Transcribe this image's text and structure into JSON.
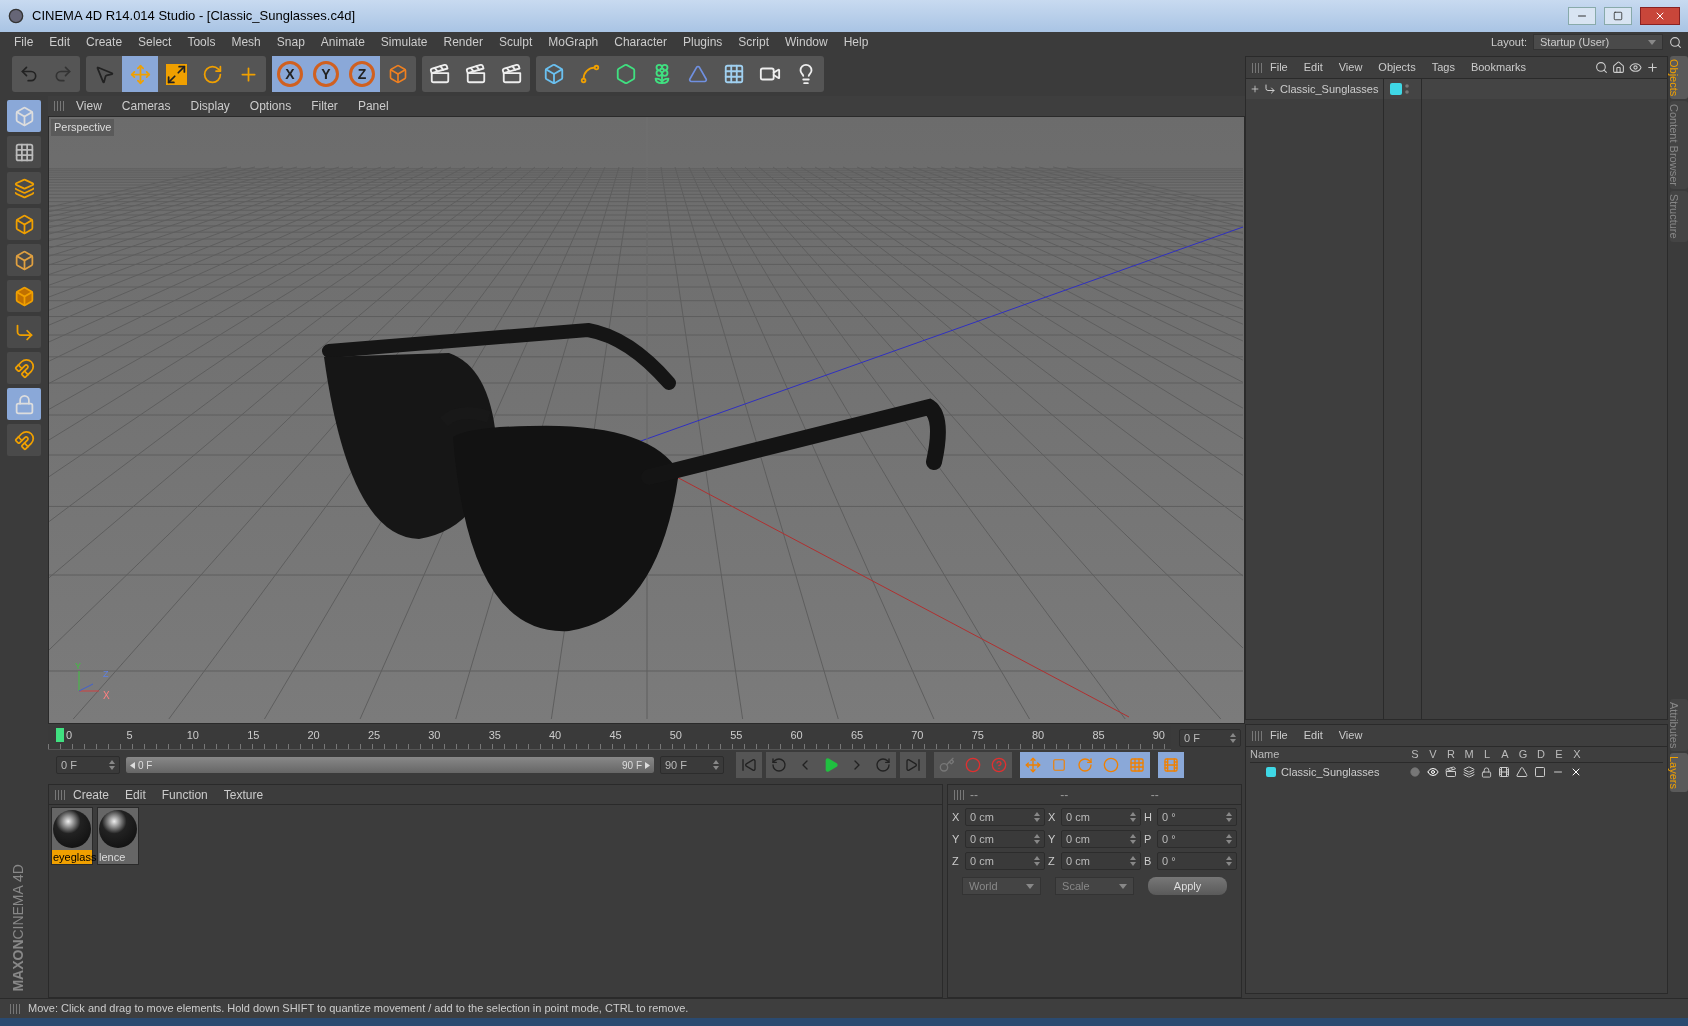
{
  "window": {
    "title": "CINEMA 4D R14.014 Studio - [Classic_Sunglasses.c4d]"
  },
  "menu": [
    "File",
    "Edit",
    "Create",
    "Select",
    "Tools",
    "Mesh",
    "Snap",
    "Animate",
    "Simulate",
    "Render",
    "Sculpt",
    "MoGraph",
    "Character",
    "Plugins",
    "Script",
    "Window",
    "Help"
  ],
  "layout": {
    "label": "Layout:",
    "value": "Startup (User)"
  },
  "tools": [
    {
      "kind": "select",
      "selected": false
    },
    {
      "kind": "move",
      "selected": true
    },
    {
      "kind": "scale",
      "selected": false
    },
    {
      "kind": "rotate",
      "selected": false
    },
    {
      "kind": "add",
      "selected": false
    }
  ],
  "axes": [
    {
      "label": "X",
      "selected": true
    },
    {
      "label": "Y",
      "selected": true
    },
    {
      "label": "Z",
      "selected": true
    }
  ],
  "left_tools": [
    {
      "kind": "model",
      "selected": true
    },
    {
      "kind": "texture",
      "selected": false
    },
    {
      "kind": "workplane",
      "selected": false
    },
    {
      "kind": "points",
      "selected": false
    },
    {
      "kind": "edges",
      "selected": false
    },
    {
      "kind": "polygons",
      "selected": false
    },
    {
      "kind": "axis",
      "selected": false
    },
    {
      "kind": "magnet",
      "selected": false
    },
    {
      "kind": "lock",
      "selected": true
    },
    {
      "kind": "snap",
      "selected": false
    }
  ],
  "viewport": {
    "menu": [
      "View",
      "Cameras",
      "Display",
      "Options",
      "Filter",
      "Panel"
    ],
    "label": "Perspective",
    "axis_labels": [
      "Y",
      "Z",
      "X"
    ]
  },
  "timeline": {
    "ticks": [
      "0",
      "5",
      "10",
      "15",
      "20",
      "25",
      "30",
      "35",
      "40",
      "45",
      "50",
      "55",
      "60",
      "65",
      "70",
      "75",
      "80",
      "85",
      "90"
    ],
    "current": "0 F",
    "start": "0 F",
    "range_start": "0 F",
    "range_end": "90 F",
    "range_bar": {
      "level": 1
    },
    "end": "90 F"
  },
  "materials": {
    "menu": [
      "Create",
      "Edit",
      "Function",
      "Texture"
    ],
    "items": [
      {
        "name": "eyeglass",
        "selected": true
      },
      {
        "name": "lence",
        "selected": false
      }
    ]
  },
  "coordinates": {
    "headers": [
      "--",
      "--",
      "--"
    ],
    "rows": [
      {
        "a1": "X",
        "v1": "0 cm",
        "a2": "X",
        "v2": "0 cm",
        "a3": "H",
        "v3": "0 °"
      },
      {
        "a1": "Y",
        "v1": "0 cm",
        "a2": "Y",
        "v2": "0 cm",
        "a3": "P",
        "v3": "0 °"
      },
      {
        "a1": "Z",
        "v1": "0 cm",
        "a2": "Z",
        "v2": "0 cm",
        "a3": "B",
        "v3": "0 °"
      }
    ],
    "dropdowns": [
      "World",
      "Scale"
    ],
    "apply": "Apply"
  },
  "logo": {
    "line1": "MAXON",
    "line2": "CINEMA 4D"
  },
  "objects": {
    "menu": [
      "File",
      "Edit",
      "View",
      "Objects",
      "Tags",
      "Bookmarks"
    ],
    "items": [
      {
        "name": "Classic_Sunglasses",
        "color": "#3fd8e6"
      }
    ]
  },
  "side_tabs": [
    {
      "label": "Objects",
      "selected": true
    },
    {
      "label": "Content Browser",
      "selected": false
    },
    {
      "label": "Structure",
      "selected": false
    }
  ],
  "layers": {
    "menu": [
      "File",
      "Edit",
      "View"
    ],
    "columns": [
      "Name",
      "S",
      "V",
      "R",
      "M",
      "L",
      "A",
      "G",
      "D",
      "E",
      "X"
    ],
    "rows": [
      {
        "name": "Classic_Sunglasses",
        "color": "#3fd8e6"
      }
    ]
  },
  "side_tabs_lower": [
    {
      "label": "Attributes",
      "selected": false
    },
    {
      "label": "Layers",
      "selected": true
    }
  ],
  "status_bar": "Move: Click and drag to move elements. Hold down SHIFT to quantize movement / add to the selection in point mode, CTRL to remove."
}
